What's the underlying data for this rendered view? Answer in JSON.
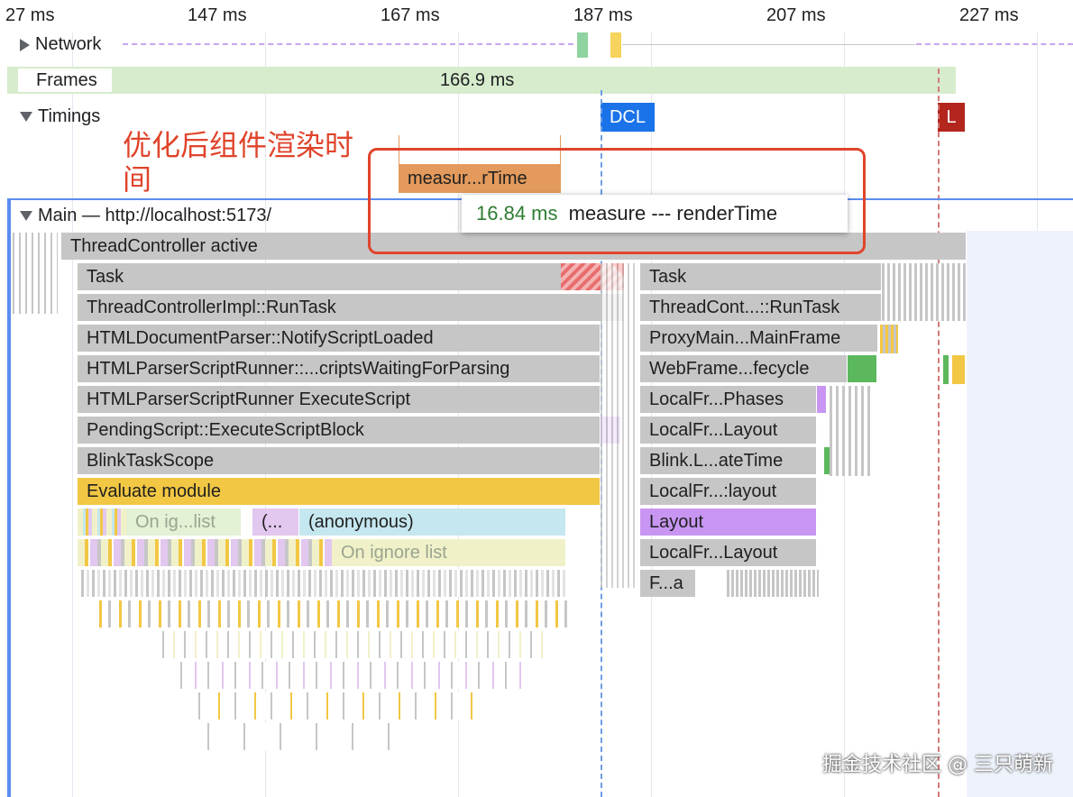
{
  "ruler": {
    "ticks": [
      "27 ms",
      "147 ms",
      "167 ms",
      "187 ms",
      "207 ms",
      "227 ms"
    ]
  },
  "tracks": {
    "network_label": "Network",
    "frames_label": "Frames",
    "frames_duration": "166.9 ms",
    "timings_label": "Timings",
    "dcl_marker": "DCL",
    "load_marker": "L",
    "measure_bar": "measur...rTime",
    "main_label": "Main — http://localhost:5173/"
  },
  "annotation": {
    "text": "优化后组件渲染时间",
    "color": "#e0442b"
  },
  "tooltip": {
    "duration": "16.84 ms",
    "name": "measure --- renderTime",
    "duration_color": "#2e7d32"
  },
  "flame_left": [
    "ThreadController active",
    "Task",
    "ThreadControllerImpl::RunTask",
    "HTMLDocumentParser::NotifyScriptLoaded",
    "HTMLParserScriptRunner::...criptsWaitingForParsing",
    "HTMLParserScriptRunner ExecuteScript",
    "PendingScript::ExecuteScriptBlock",
    "BlinkTaskScope",
    "Evaluate module"
  ],
  "flame_left_children": {
    "on_ignore_short": "On ig...list",
    "paren": "(...",
    "anonymous": "(anonymous)",
    "on_ignore_list": "On ignore list"
  },
  "flame_right": [
    "Task",
    "ThreadCont...::RunTask",
    "ProxyMain...MainFrame",
    "WebFrame...fecycle",
    "LocalFr...Phases",
    "LocalFr...Layout",
    "Blink.L...ateTime",
    "LocalFr...:layout",
    "Layout",
    "LocalFr...Layout",
    "F...a"
  ],
  "watermark": "掘金技术社区 @ 三只萌新",
  "colors": {
    "scripting": "#f2c744",
    "rendering": "#c896f2",
    "system": "#c6c6c6",
    "dcl": "#1a73e8",
    "load": "#b3261e",
    "measure": "#e39a5c",
    "frames": "#d6eccc"
  }
}
